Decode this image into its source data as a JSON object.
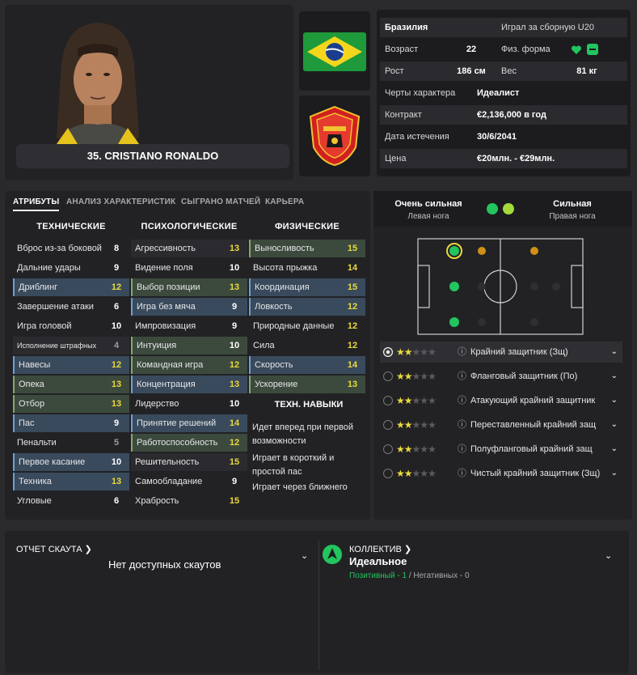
{
  "player": {
    "name": "35. CRISTIANO RONALDO"
  },
  "info": {
    "nation": "Бразилия",
    "intl": "Играл за сборную U20",
    "age_label": "Возраст",
    "age": "22",
    "fitness_label": "Физ. форма",
    "height_label": "Рост",
    "height": "186 см",
    "weight_label": "Вес",
    "weight": "81 кг",
    "personality_label": "Черты характера",
    "personality": "Идеалист",
    "contract_label": "Контракт",
    "contract": "€2,136,000 в год",
    "expiry_label": "Дата истечения",
    "expiry": "30/6/2041",
    "value_label": "Цена",
    "value": "€20млн. - €29млн."
  },
  "tabs": [
    "АТРИБУТЫ",
    "АНАЛИЗ ХАРАКТЕРИСТИК",
    "СЫГРАНО МАТЧЕЙ",
    "КАРЬЕРА"
  ],
  "columns": {
    "technical": "ТЕХНИЧЕСКИЕ",
    "mental": "ПСИХОЛОГИЧЕСКИЕ",
    "physical": "ФИЗИЧЕСКИЕ"
  },
  "technical": [
    {
      "label": "Вброс из-за боковой",
      "value": "8"
    },
    {
      "label": "Дальние удары",
      "value": "9"
    },
    {
      "label": "Дриблинг",
      "value": "12"
    },
    {
      "label": "Завершение атаки",
      "value": "6"
    },
    {
      "label": "Игра головой",
      "value": "10"
    },
    {
      "label": "Исполнение штрафных",
      "value": "4"
    },
    {
      "label": "Навесы",
      "value": "12"
    },
    {
      "label": "Опека",
      "value": "13"
    },
    {
      "label": "Отбор",
      "value": "13"
    },
    {
      "label": "Пас",
      "value": "9"
    },
    {
      "label": "Пенальти",
      "value": "5"
    },
    {
      "label": "Первое касание",
      "value": "10"
    },
    {
      "label": "Техника",
      "value": "13"
    },
    {
      "label": "Угловые",
      "value": "6"
    }
  ],
  "mental": [
    {
      "label": "Агрессивность",
      "value": "13"
    },
    {
      "label": "Видение поля",
      "value": "10"
    },
    {
      "label": "Выбор позиции",
      "value": "13"
    },
    {
      "label": "Игра без мяча",
      "value": "9"
    },
    {
      "label": "Импровизация",
      "value": "9"
    },
    {
      "label": "Интуиция",
      "value": "10"
    },
    {
      "label": "Командная игра",
      "value": "12"
    },
    {
      "label": "Концентрация",
      "value": "13"
    },
    {
      "label": "Лидерство",
      "value": "10"
    },
    {
      "label": "Принятие решений",
      "value": "14"
    },
    {
      "label": "Работоспособность",
      "value": "12"
    },
    {
      "label": "Решительность",
      "value": "15"
    },
    {
      "label": "Самообладание",
      "value": "9"
    },
    {
      "label": "Храбрость",
      "value": "15"
    }
  ],
  "physical": [
    {
      "label": "Выносливость",
      "value": "15"
    },
    {
      "label": "Высота прыжка",
      "value": "14"
    },
    {
      "label": "Координация",
      "value": "15"
    },
    {
      "label": "Ловкость",
      "value": "12"
    },
    {
      "label": "Природные данные",
      "value": "12"
    },
    {
      "label": "Сила",
      "value": "12"
    },
    {
      "label": "Скорость",
      "value": "14"
    },
    {
      "label": "Ускорение",
      "value": "13"
    }
  ],
  "traits": {
    "title": "ТЕХН. НАВЫКИ",
    "items": [
      "Идет вперед при первой возможности",
      "Играет в короткий и простой пас",
      "Играет через ближнего"
    ]
  },
  "feet": {
    "left_strength": "Очень сильная",
    "left_label": "Левая нога",
    "right_strength": "Сильная",
    "right_label": "Правая нога"
  },
  "roles": [
    {
      "name": "Крайний защитник (Зщ)",
      "stars": 2
    },
    {
      "name": "Фланговый защитник (По)",
      "stars": 2
    },
    {
      "name": "Атакующий крайний защитник",
      "stars": 2
    },
    {
      "name": "Переставленный крайний защ",
      "stars": 2
    },
    {
      "name": "Полуфланговый крайний защ",
      "stars": 2
    },
    {
      "name": "Чистый крайний защитник (Зщ)",
      "stars": 2
    }
  ],
  "scout": {
    "title": "ОТЧЕТ СКАУТА",
    "none": "Нет доступных скаутов"
  },
  "collective": {
    "title": "КОЛЛЕКТИВ",
    "value": "Идеальное",
    "positive": "Позитивный - 1",
    "sep": "/",
    "negative": "Негативных - 0"
  },
  "colors": {
    "accent_green": "#22c55e",
    "star": "#e9d83c"
  },
  "icons": {
    "fitness": "heart-icon",
    "info": "info-icon",
    "chevron": "chevron-down-icon"
  }
}
